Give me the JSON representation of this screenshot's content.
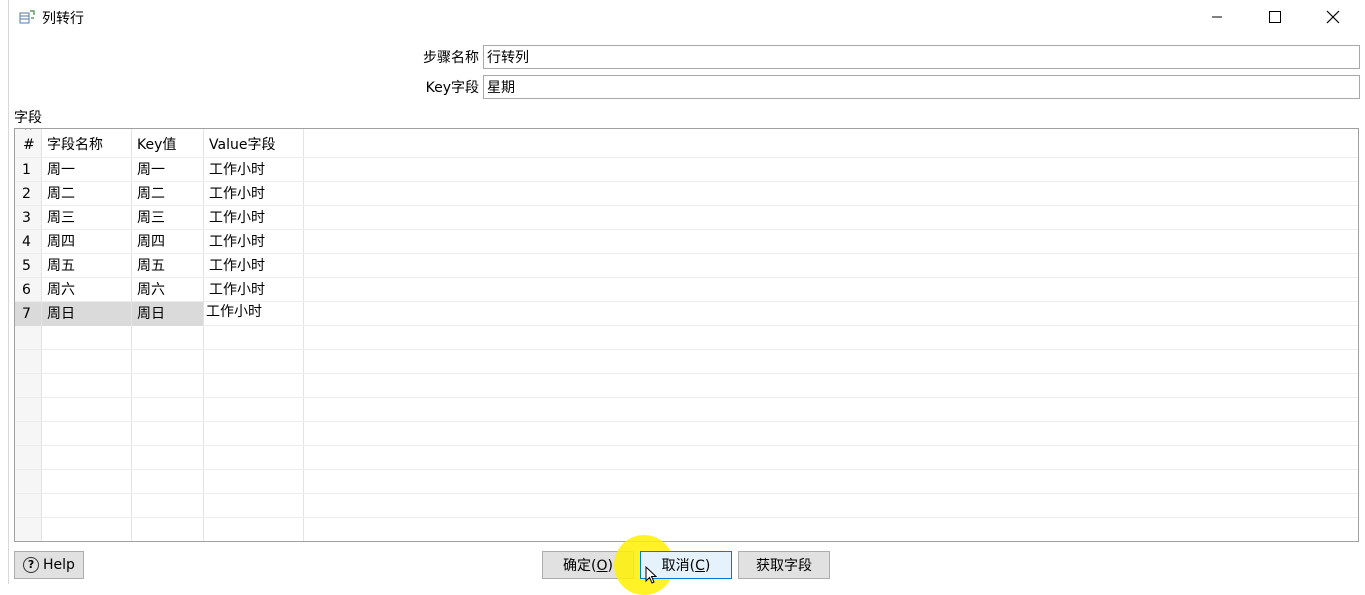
{
  "window": {
    "title": "列转行",
    "icon": "transform-step-icon",
    "controls": [
      "minimize-icon",
      "maximize-icon",
      "close-icon"
    ]
  },
  "form": {
    "step_name_label": "步骤名称",
    "step_name_value": "行转列",
    "key_field_label": "Key字段",
    "key_field_value": "星期"
  },
  "fields": {
    "section_label": "字段",
    "sort_indicator": "^",
    "columns": [
      "#",
      "字段名称",
      "Key值",
      "Value字段"
    ],
    "rows": [
      {
        "num": "1",
        "name": "周一",
        "key": "周一",
        "value": "工作小时"
      },
      {
        "num": "2",
        "name": "周二",
        "key": "周二",
        "value": "工作小时"
      },
      {
        "num": "3",
        "name": "周三",
        "key": "周三",
        "value": "工作小时"
      },
      {
        "num": "4",
        "name": "周四",
        "key": "周四",
        "value": "工作小时"
      },
      {
        "num": "5",
        "name": "周五",
        "key": "周五",
        "value": "工作小时"
      },
      {
        "num": "6",
        "name": "周六",
        "key": "周六",
        "value": "工作小时"
      },
      {
        "num": "7",
        "name": "周日",
        "key": "周日",
        "value": "工作小时"
      }
    ],
    "selected_row": 7
  },
  "buttons": {
    "help": "Help",
    "ok_text": "确定(",
    "ok_mnemonic": "O",
    "ok_close": ")",
    "cancel_text": "取消(",
    "cancel_mnemonic": "C",
    "cancel_close": ")",
    "get_fields": "获取字段"
  },
  "colors": {
    "selected_row_bg": "#dadada",
    "focus_border": "#0078d7",
    "cursor_highlight": "#fff000"
  }
}
